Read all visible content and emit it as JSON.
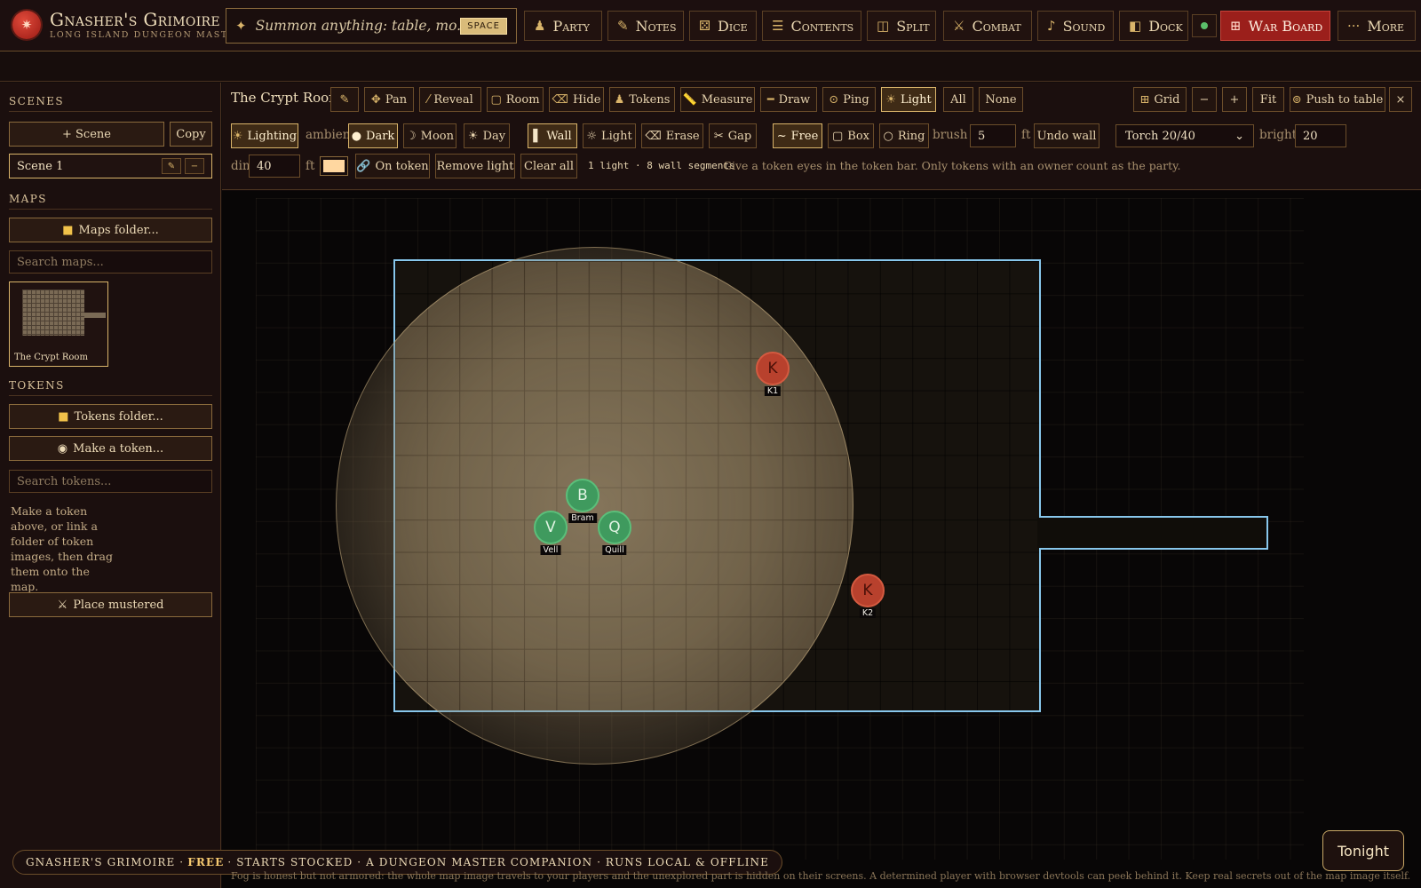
{
  "app": {
    "brand_title": "Gnasher's Grimoire",
    "brand_subtitle": "Long Island Dungeon Master",
    "summon_placeholder": "Summon anything: table, mo...",
    "summon_key": "SPACE"
  },
  "nav": {
    "party": "Party",
    "notes": "Notes",
    "dice": "Dice",
    "contents": "Contents",
    "split": "Split",
    "combat": "Combat",
    "sound": "Sound",
    "dock": "Dock",
    "war_board": "War Board",
    "more": "More"
  },
  "sidebar": {
    "scenes_heading": "Scenes",
    "add_scene": "+ Scene",
    "copy": "Copy",
    "current_scene": "Scene 1",
    "maps_heading": "Maps",
    "maps_folder": "Maps folder...",
    "search_maps": "Search maps...",
    "map_name": "The Crypt Room",
    "tokens_heading": "Tokens",
    "tokens_folder": "Tokens folder...",
    "make_token": "Make a token...",
    "search_tokens": "Search tokens...",
    "help_text": "Make a token above, or link a folder of token images, then drag them onto the map.",
    "place_mustered": "Place mustered"
  },
  "toolbar": {
    "scene_title": "The Crypt Room",
    "pan": "Pan",
    "reveal": "Reveal",
    "room": "Room",
    "hide": "Hide",
    "tokens": "Tokens",
    "measure": "Measure",
    "draw": "Draw",
    "ping": "Ping",
    "light": "Light",
    "all": "All",
    "none": "None",
    "grid": "Grid",
    "zoom_out": "−",
    "zoom_in": "+",
    "fit": "Fit",
    "push": "Push to table",
    "close": "×"
  },
  "lighting": {
    "lighting": "Lighting",
    "ambient_label": "ambient",
    "dark": "Dark",
    "moon": "Moon",
    "day": "Day",
    "wall": "Wall",
    "light": "Light",
    "erase": "Erase",
    "gap": "Gap",
    "free": "Free",
    "box": "Box",
    "ring": "Ring",
    "brush_label": "brush",
    "brush_value": "5",
    "unit": "ft",
    "undo_wall": "Undo wall",
    "light_preset": "Torch 20/40",
    "bright_label": "bright",
    "bright_value": "20",
    "dim_label": "dim",
    "dim_value": "40",
    "dim_unit": "ft",
    "light_color": "#ffd7a0",
    "on_token": "On token",
    "remove_light": "Remove light",
    "clear_all": "Clear all",
    "summary": "1 light · 8 wall segments",
    "hint": "Give a token eyes in the token bar. Only tokens with an owner count as the party."
  },
  "tokens": [
    {
      "letter": "K",
      "label": "K1",
      "kind": "foe"
    },
    {
      "letter": "B",
      "label": "Bram",
      "kind": "party"
    },
    {
      "letter": "V",
      "label": "Vell",
      "kind": "party"
    },
    {
      "letter": "Q",
      "label": "Quill",
      "kind": "party"
    },
    {
      "letter": "K",
      "label": "K2",
      "kind": "foe"
    }
  ],
  "footer": {
    "name": "GNASHER'S GRIMOIRE ·",
    "free": "FREE",
    "rest": "· STARTS STOCKED · A DUNGEON MASTER COMPANION · RUNS LOCAL & OFFLINE",
    "disclaimer": "Fog is honest but not armored: the whole map image travels to your players and the unexplored part is hidden on their screens. A determined player with browser devtools can peek behind it. Keep real secrets out of the map image itself.",
    "tonight": "Tonight"
  }
}
